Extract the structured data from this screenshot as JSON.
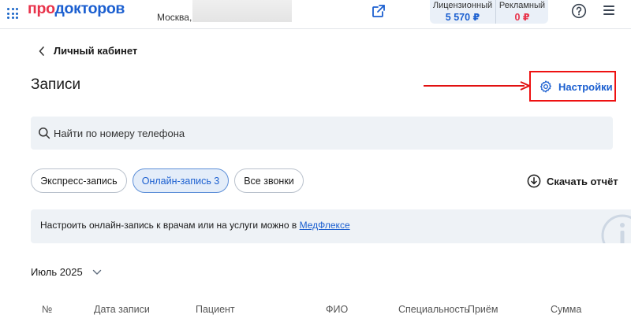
{
  "header": {
    "logo_part1": "про",
    "logo_part2": "докторов",
    "city": "Москва,",
    "balances": [
      {
        "label": "Лицензионный",
        "value": "5 570 ₽"
      },
      {
        "label": "Рекламный",
        "value": "0 ₽"
      }
    ]
  },
  "nav": {
    "back_label": "Личный кабинет"
  },
  "page": {
    "title": "Записи",
    "settings_label": "Настройки"
  },
  "search": {
    "placeholder": "Найти по номеру телефона"
  },
  "filters": {
    "chips": [
      "Экспресс-запись",
      "Онлайн-запись 3",
      "Все звонки"
    ],
    "active_index": 1
  },
  "download_label": "Скачать отчёт",
  "info": {
    "text": "Настроить онлайн-запись к врачам или на услуги можно в ",
    "link": "МедФлексе"
  },
  "month": "Июль 2025",
  "table": {
    "columns": [
      "№",
      "Дата записи",
      "Пациент",
      "ФИО",
      "Специальность",
      "Приём",
      "Сумма"
    ]
  },
  "colors": {
    "accent_blue": "#1b5fd0",
    "accent_red": "#e8334b",
    "annotation_red": "#e11111"
  }
}
